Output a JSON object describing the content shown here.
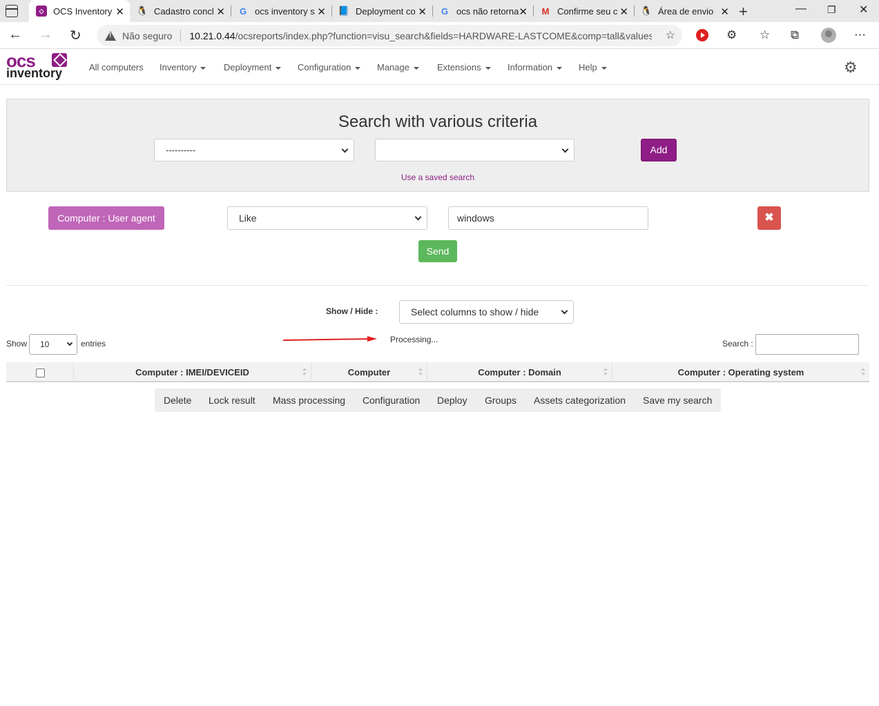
{
  "browser": {
    "tabs": [
      {
        "title": "OCS Inventory",
        "icon": "ocs-favicon",
        "active": true
      },
      {
        "title": "Cadastro concl",
        "icon": "linux-penguin-icon",
        "active": false
      },
      {
        "title": "ocs inventory s",
        "icon": "google-icon",
        "active": false
      },
      {
        "title": "Deployment co",
        "icon": "book-icon",
        "active": false
      },
      {
        "title": "ocs não retorna",
        "icon": "google-icon",
        "active": false
      },
      {
        "title": "Confirme seu c",
        "icon": "gmail-icon",
        "active": false
      },
      {
        "title": "Área de envio",
        "icon": "linux-penguin-icon",
        "active": false
      }
    ],
    "security_label": "Não seguro",
    "url_host": "10.21.0.44",
    "url_path": "/ocsreports/index.php?function=visu_search&fields=HARDWARE-LASTCOME&comp=tall&values..."
  },
  "app": {
    "logo_top": "ocs",
    "logo_bottom": "inventory",
    "nav": [
      {
        "label": "All computers",
        "dropdown": false
      },
      {
        "label": "Inventory",
        "dropdown": true
      },
      {
        "label": "Deployment",
        "dropdown": true
      },
      {
        "label": "Configuration",
        "dropdown": true
      },
      {
        "label": "Manage",
        "dropdown": true
      },
      {
        "label": "Extensions",
        "dropdown": true
      },
      {
        "label": "Information",
        "dropdown": true
      },
      {
        "label": "Help",
        "dropdown": true
      }
    ]
  },
  "search_panel": {
    "title": "Search with various criteria",
    "field_select_value": "----------",
    "operator_select_value": "",
    "add_label": "Add",
    "saved_search_link": "Use a saved search"
  },
  "criteria": {
    "field_label": "Computer : User agent",
    "operator_value": "Like",
    "value": "windows",
    "remove_icon": "✖",
    "send_label": "Send"
  },
  "results": {
    "showhide_label": "Show / Hide :",
    "showhide_select_value": "Select columns to show / hide",
    "show_label": "Show",
    "entries_value": "10",
    "entries_label": "entries",
    "processing_text": "Processing...",
    "search_label": "Search :",
    "columns": [
      "Computer : IMEI/DEVICEID",
      "Computer",
      "Computer : Domain",
      "Computer : Operating system"
    ],
    "actions": [
      "Delete",
      "Lock result",
      "Mass processing",
      "Configuration",
      "Deploy",
      "Groups",
      "Assets categorization",
      "Save my search"
    ]
  },
  "colors": {
    "brand": "#8e1d85",
    "criteria_label": "#c066b9",
    "danger": "#d9534f",
    "success": "#5cb85c",
    "annotation_arrow": "#e02020"
  }
}
